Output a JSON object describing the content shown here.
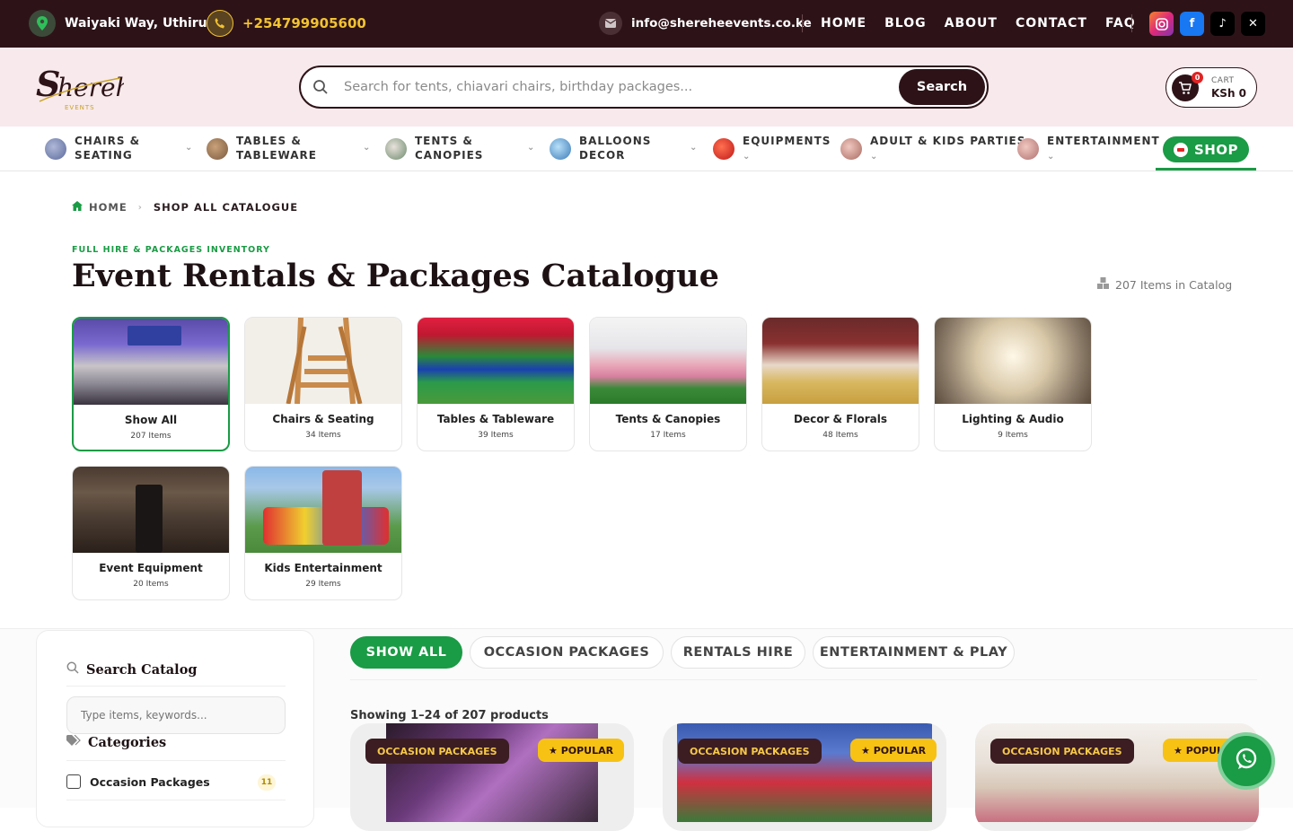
{
  "topbar": {
    "location": "Waiyaki Way, Uthiru",
    "phone": "+254799905600",
    "email": "info@shereheevents.co.ke",
    "nav": [
      "HOME",
      "BLOG",
      "ABOUT",
      "CONTACT",
      "FAQ"
    ],
    "socials": [
      "instagram-icon",
      "facebook-icon",
      "tiktok-icon",
      "x-icon"
    ],
    "colors": {
      "bg": "#2d1318",
      "phone": "#f2c230"
    }
  },
  "header": {
    "logo_text": "Sherehe",
    "logo_sub": "EVENTS",
    "search_placeholder": "Search for tents, chiavari chairs, birthday packages...",
    "search_button": "Search",
    "cart_label": "CART",
    "cart_value": "KSh 0",
    "cart_count": "0"
  },
  "catnav": {
    "items": [
      {
        "line1": "CHAIRS &",
        "line2": "SEATING"
      },
      {
        "line1": "TABLES &",
        "line2": "TABLEWARE"
      },
      {
        "line1": "TENTS &",
        "line2": "CANOPIES"
      },
      {
        "line1": "BALLOONS",
        "line2": "DECOR"
      },
      {
        "line1": "EQUIPMENTS",
        "line2": ""
      },
      {
        "line1": "ADULT & KIDS PARTIES",
        "line2": ""
      },
      {
        "line1": "ENTERTAINMENT",
        "line2": ""
      }
    ],
    "shop": "SHOP",
    "accent": "#1a9b45"
  },
  "breadcrumb": {
    "home": "HOME",
    "current": "SHOP ALL CATALOGUE"
  },
  "page": {
    "eyebrow": "FULL HIRE & PACKAGES INVENTORY",
    "title": "Event Rentals & Packages Catalogue",
    "count": "207 Items in Catalog"
  },
  "categories": [
    {
      "name": "Show All",
      "count": "207 Items"
    },
    {
      "name": "Chairs & Seating",
      "count": "34 Items"
    },
    {
      "name": "Tables & Tableware",
      "count": "39 Items"
    },
    {
      "name": "Tents & Canopies",
      "count": "17 Items"
    },
    {
      "name": "Decor & Florals",
      "count": "48 Items"
    },
    {
      "name": "Lighting & Audio",
      "count": "9 Items"
    },
    {
      "name": "Event Equipment",
      "count": "20 Items"
    },
    {
      "name": "Kids Entertainment",
      "count": "29 Items"
    }
  ],
  "sidebar": {
    "search_title": "Search Catalog",
    "search_placeholder": "Type items, keywords...",
    "cats_title": "Categories",
    "cat_items": [
      {
        "label": "Occasion Packages",
        "count": "11"
      }
    ]
  },
  "filters": {
    "tabs": [
      "SHOW ALL",
      "OCCASION PACKAGES",
      "RENTALS HIRE",
      "ENTERTAINMENT & PLAY"
    ],
    "showing": "Showing 1–24 of 207 products"
  },
  "products": [
    {
      "tag": "OCCASION PACKAGES",
      "badge": "★ POPULAR"
    },
    {
      "tag": "OCCASION PACKAGES",
      "badge": "★ POPULAR"
    },
    {
      "tag": "OCCASION PACKAGES",
      "badge": "★ POPULA"
    }
  ]
}
